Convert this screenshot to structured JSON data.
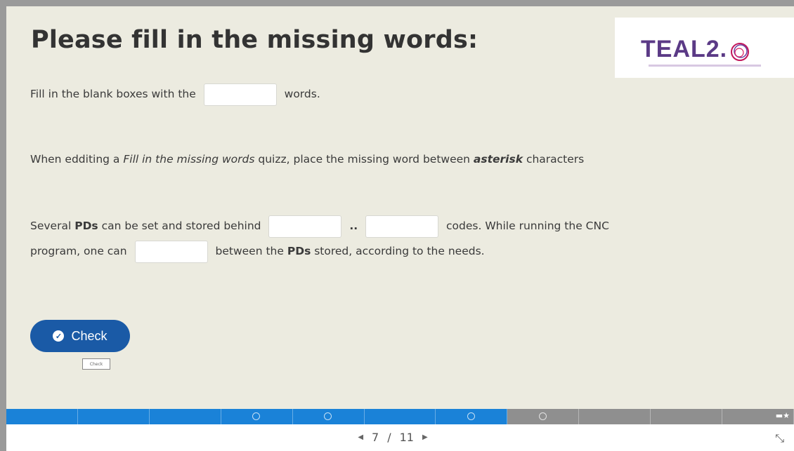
{
  "slide": {
    "title": "Please fill in the missing words:",
    "logo_text": "TEAL2.",
    "paragraphs": {
      "p1_before": "Fill in the blank boxes with the",
      "p1_after": "words.",
      "p2_a": "When edditing a ",
      "p2_italic": "Fill in the missing words",
      "p2_b": " quizz, place the missing word between ",
      "p2_bold_italic": "asterisk",
      "p2_c": " characters",
      "p3_a": "Several ",
      "p3_bold1": "PDs",
      "p3_b": " can be set and stored behind",
      "p3_sep": "..",
      "p3_c": "codes. While running the CNC",
      "p4_a": "program, one can",
      "p4_b": "between the ",
      "p4_bold": "PDs",
      "p4_c": " stored, according to the needs."
    },
    "blanks": [
      "",
      "",
      "",
      ""
    ]
  },
  "check_button": {
    "label": "Check",
    "tooltip": "Check"
  },
  "progress": {
    "total_segments": 11,
    "completed_segments": 7,
    "tools_icon": "expand-collapse-icon"
  },
  "navigation": {
    "current": "7",
    "separator": "/",
    "total": "11",
    "prev_icon": "caret-left-icon",
    "next_icon": "caret-right-icon"
  },
  "fullscreen_icon": "exit-fullscreen-icon",
  "colors": {
    "slide_bg": "#ecebe0",
    "accent": "#1a5aa6",
    "progress_done": "#1a82d8",
    "progress_todo": "#8f8f8f",
    "logo": "#5b3a86"
  }
}
